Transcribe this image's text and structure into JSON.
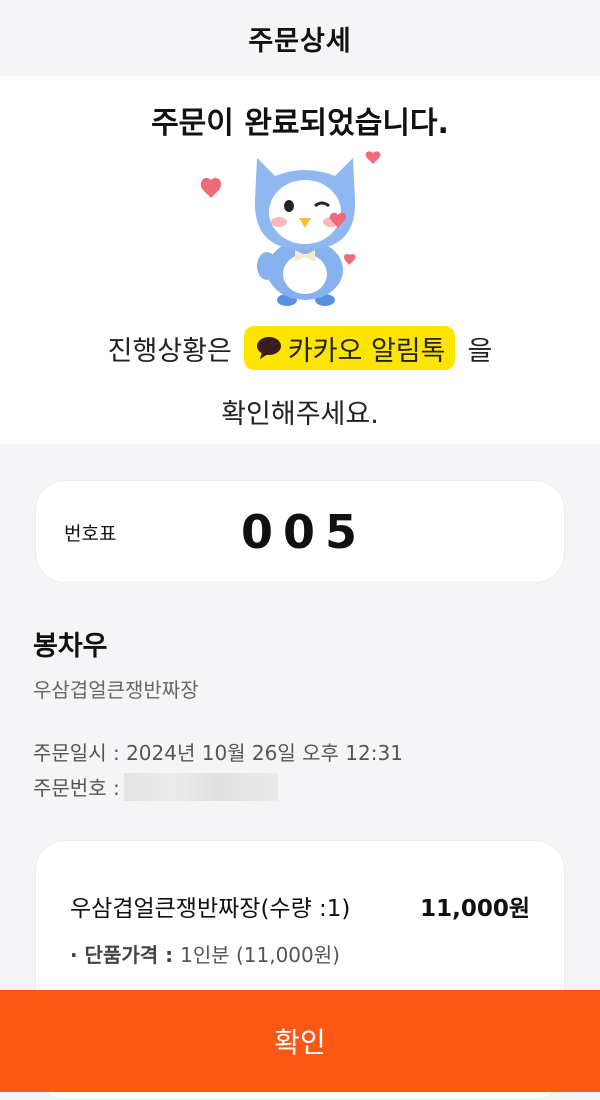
{
  "header": {
    "title": "주문상세"
  },
  "hero": {
    "title": "주문이 완료되었습니다.",
    "line1_prefix": "진행상황은",
    "kakao_badge": "카카오 알림톡",
    "line1_suffix": "을",
    "line2": "확인해주세요."
  },
  "ticket": {
    "label": "번호표",
    "number": "005"
  },
  "store": {
    "name": "봉차우",
    "sub": "우삼겹얼큰쟁반짜장",
    "order_time_label": "주문일시 : ",
    "order_time": "2024년 10월 26일 오후 12:31",
    "order_no_label": "주문번호 : "
  },
  "item": {
    "name": "우삼겹얼큰쟁반짜장(수량 :1)",
    "price": "11,000원",
    "unit_label": "· 단품가격 : ",
    "unit_value": "1인분 (11,000원)"
  },
  "confirm": {
    "label": "확인"
  },
  "colors": {
    "accent": "#fd5716",
    "kakao_yellow": "#fee500",
    "mascot_blue": "#8fb8f0"
  }
}
